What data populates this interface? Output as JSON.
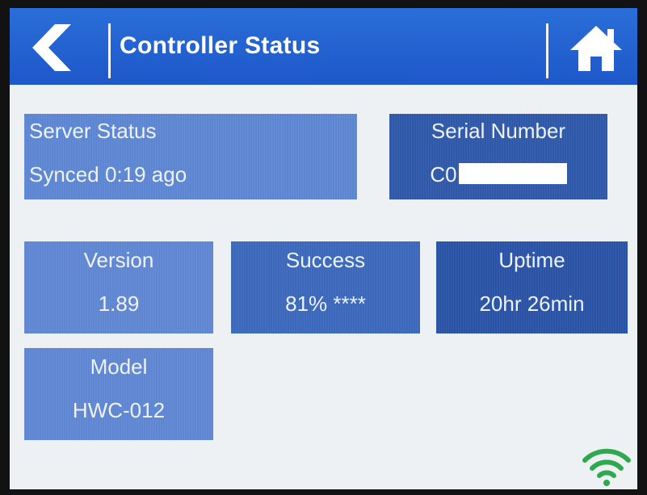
{
  "header": {
    "title": "Controller Status",
    "back_icon": "chevron-left-icon",
    "home_icon": "home-icon"
  },
  "tiles": {
    "server_status": {
      "label": "Server Status",
      "value": "Synced 0:19 ago"
    },
    "serial_number": {
      "label": "Serial Number",
      "value_prefix": "C0"
    },
    "version": {
      "label": "Version",
      "value": "1.89"
    },
    "success": {
      "label": "Success",
      "value": "81% ****"
    },
    "uptime": {
      "label": "Uptime",
      "value": "20hr 26min"
    },
    "model": {
      "label": "Model",
      "value": "HWC-012"
    }
  },
  "status": {
    "wifi_icon": "wifi-icon",
    "wifi_color": "#2fa84f"
  },
  "colors": {
    "header_blue": "#2266d4",
    "screen_bg": "#eef1f3"
  }
}
